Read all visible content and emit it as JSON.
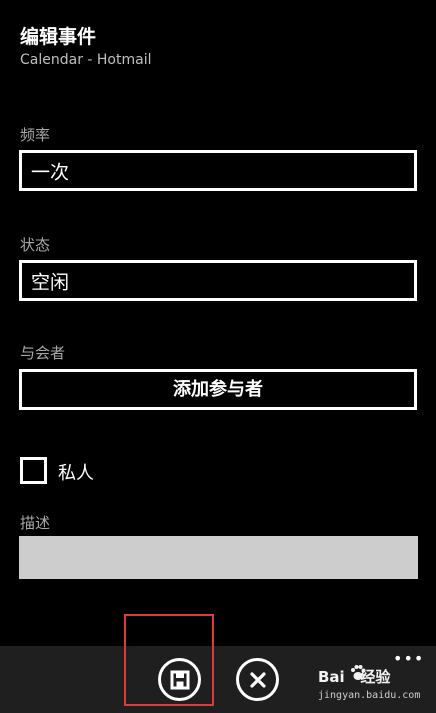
{
  "header": {
    "title": "编辑事件",
    "subtitle": "Calendar - Hotmail"
  },
  "frequency": {
    "label": "频率",
    "value": "一次"
  },
  "status": {
    "label": "状态",
    "value": "空闲"
  },
  "attendees": {
    "label": "与会者",
    "button_label": "添加参与者"
  },
  "private": {
    "label": "私人",
    "checked": false
  },
  "description": {
    "label": "描述",
    "value": ""
  },
  "appbar": {
    "buttons": [
      {
        "icon": "save-icon"
      },
      {
        "icon": "close-icon"
      }
    ],
    "more_label": "•••"
  },
  "watermark": {
    "brand": "Bai",
    "suffix": "经验",
    "url": "jingyan.baidu.com"
  },
  "colors": {
    "background": "#000000",
    "text": "#ffffff",
    "label": "#a8a8a8",
    "appbar": "#1f1f1f",
    "highlight": "#e03a3a",
    "description_field": "#cdcdcd"
  }
}
